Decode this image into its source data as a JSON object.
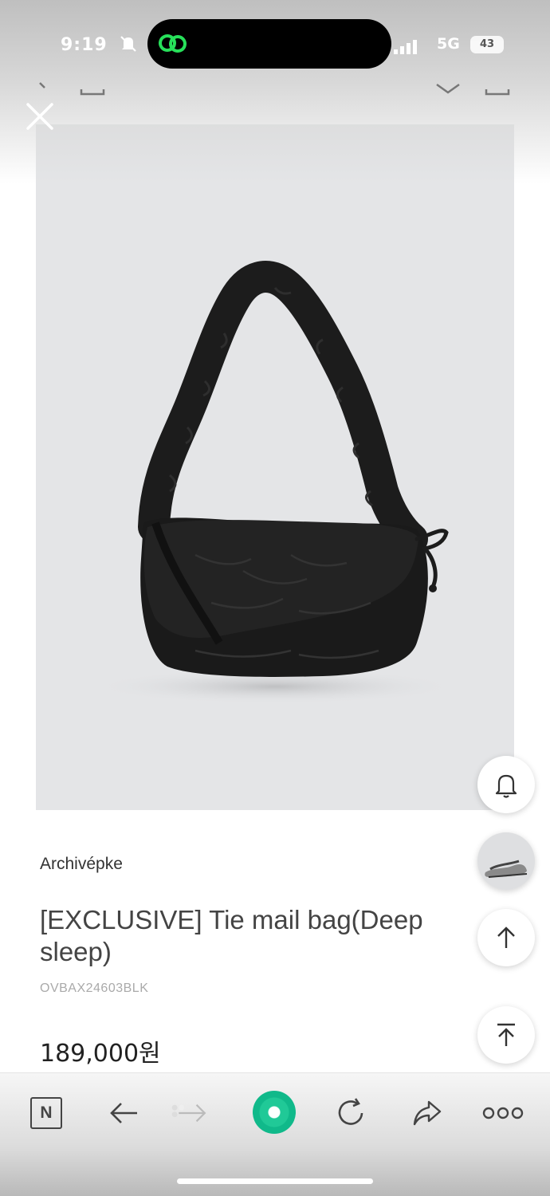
{
  "status_bar": {
    "time": "9:19",
    "network": "5G",
    "battery": "43"
  },
  "product": {
    "brand": "Archivépke",
    "title": "[EXCLUSIVE] Tie mail bag(Deep sleep)",
    "sku": "OVBAX24603BLK",
    "price": "189,000원"
  },
  "colors": {
    "accent_green": "#20c997",
    "image_bg": "#e4e5e7",
    "bag": "#1a1a1a"
  },
  "icons": {
    "close": "close-icon",
    "bell": "bell-icon",
    "arrow_up": "arrow-up-icon",
    "scroll_top": "scroll-top-icon",
    "back": "back-arrow-icon",
    "forward": "forward-arrow-icon",
    "reload": "reload-icon",
    "share": "share-icon",
    "more": "more-icon"
  },
  "toolbar": {
    "naver_label": "N"
  }
}
